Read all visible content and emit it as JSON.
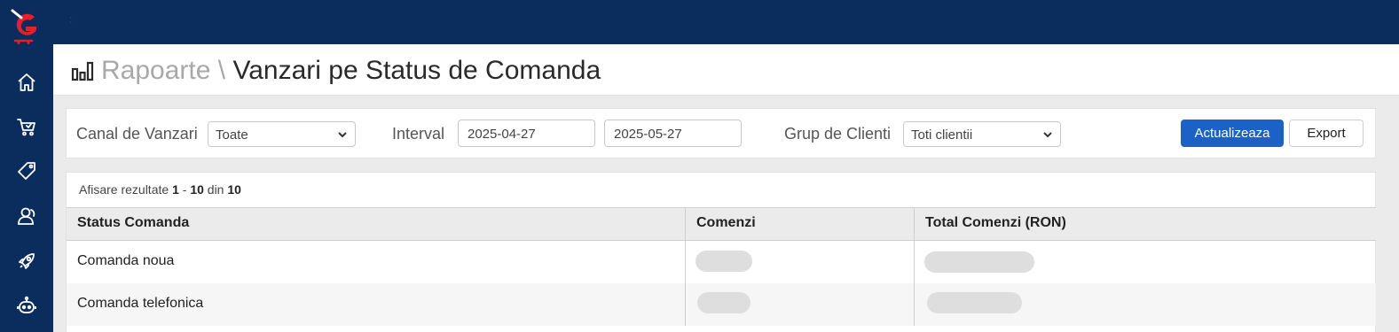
{
  "sidebar": {
    "logo": "g-logo",
    "items": [
      {
        "icon": "home-icon"
      },
      {
        "icon": "cart-icon"
      },
      {
        "icon": "tag-icon"
      },
      {
        "icon": "customers-icon"
      },
      {
        "icon": "rocket-icon"
      },
      {
        "icon": "robot-icon"
      }
    ]
  },
  "header": {
    "icon": "bar-chart-icon",
    "crumb": "Rapoarte",
    "separator": " \\ ",
    "title": "Vanzari pe Status de Comanda"
  },
  "filters": {
    "channel_label": "Canal de Vanzari",
    "channel_value": "Toate",
    "interval_label": "Interval",
    "date_from": "2025-04-27",
    "date_to": "2025-05-27",
    "group_label": "Grup de Clienti",
    "group_value": "Toti clientii",
    "update_label": "Actualizeaza",
    "export_label": "Export"
  },
  "results": {
    "prefix": "Afisare rezultate",
    "from": "1",
    "dash": " - ",
    "to": "10",
    "of_word": " din ",
    "total": "10"
  },
  "table": {
    "columns": [
      "Status Comanda",
      "Comenzi",
      "Total Comenzi (RON)"
    ],
    "rows": [
      {
        "status": "Comanda noua"
      },
      {
        "status": "Comanda telefonica"
      }
    ]
  },
  "colors": {
    "sidebar": "#0b2d5e",
    "accent": "#1b62c6",
    "logo_red": "#e4202b"
  }
}
